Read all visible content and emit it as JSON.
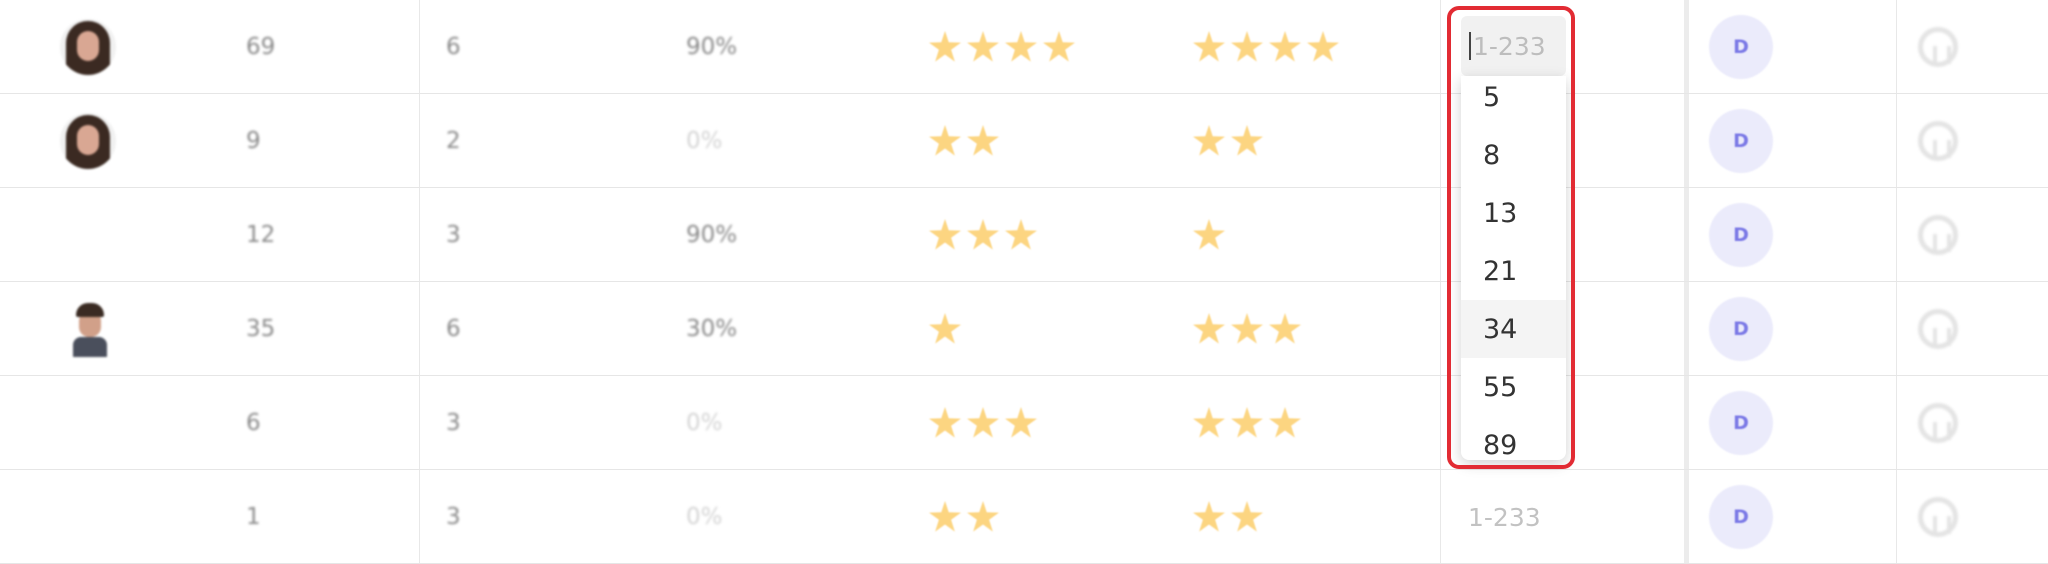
{
  "rows": [
    {
      "count": "69",
      "level": "6",
      "rate": "90%",
      "rating_a": 4,
      "rating_b": 4,
      "range_placeholder": "1-233",
      "badge": "D"
    },
    {
      "count": "9",
      "level": "2",
      "rate": "0%",
      "rating_a": 2,
      "rating_b": 2,
      "range_placeholder": "1-233",
      "badge": "D"
    },
    {
      "count": "12",
      "level": "3",
      "rate": "90%",
      "rating_a": 3,
      "rating_b": 1,
      "range_placeholder": "1-233",
      "badge": "D"
    },
    {
      "count": "35",
      "level": "6",
      "rate": "30%",
      "rating_a": 1,
      "rating_b": 3,
      "range_placeholder": "1-233",
      "badge": "D"
    },
    {
      "count": "6",
      "level": "3",
      "rate": "0%",
      "rating_a": 3,
      "rating_b": 3,
      "range_placeholder": "1-233",
      "badge": "D"
    },
    {
      "count": "1",
      "level": "3",
      "rate": "0%",
      "rating_a": 2,
      "rating_b": 2,
      "range_placeholder": "1-233",
      "badge": "D"
    }
  ],
  "editor": {
    "placeholder": "1-233",
    "value": ""
  },
  "dropdown": {
    "options": [
      "5",
      "8",
      "13",
      "21",
      "34",
      "55",
      "89"
    ],
    "hovered": "34"
  },
  "colors": {
    "star": "#fcd581",
    "badge_bg": "#ebebfb",
    "badge_text": "#7b79e6",
    "highlight": "#e22b33"
  },
  "icons": {
    "repo_link": "github-icon"
  }
}
